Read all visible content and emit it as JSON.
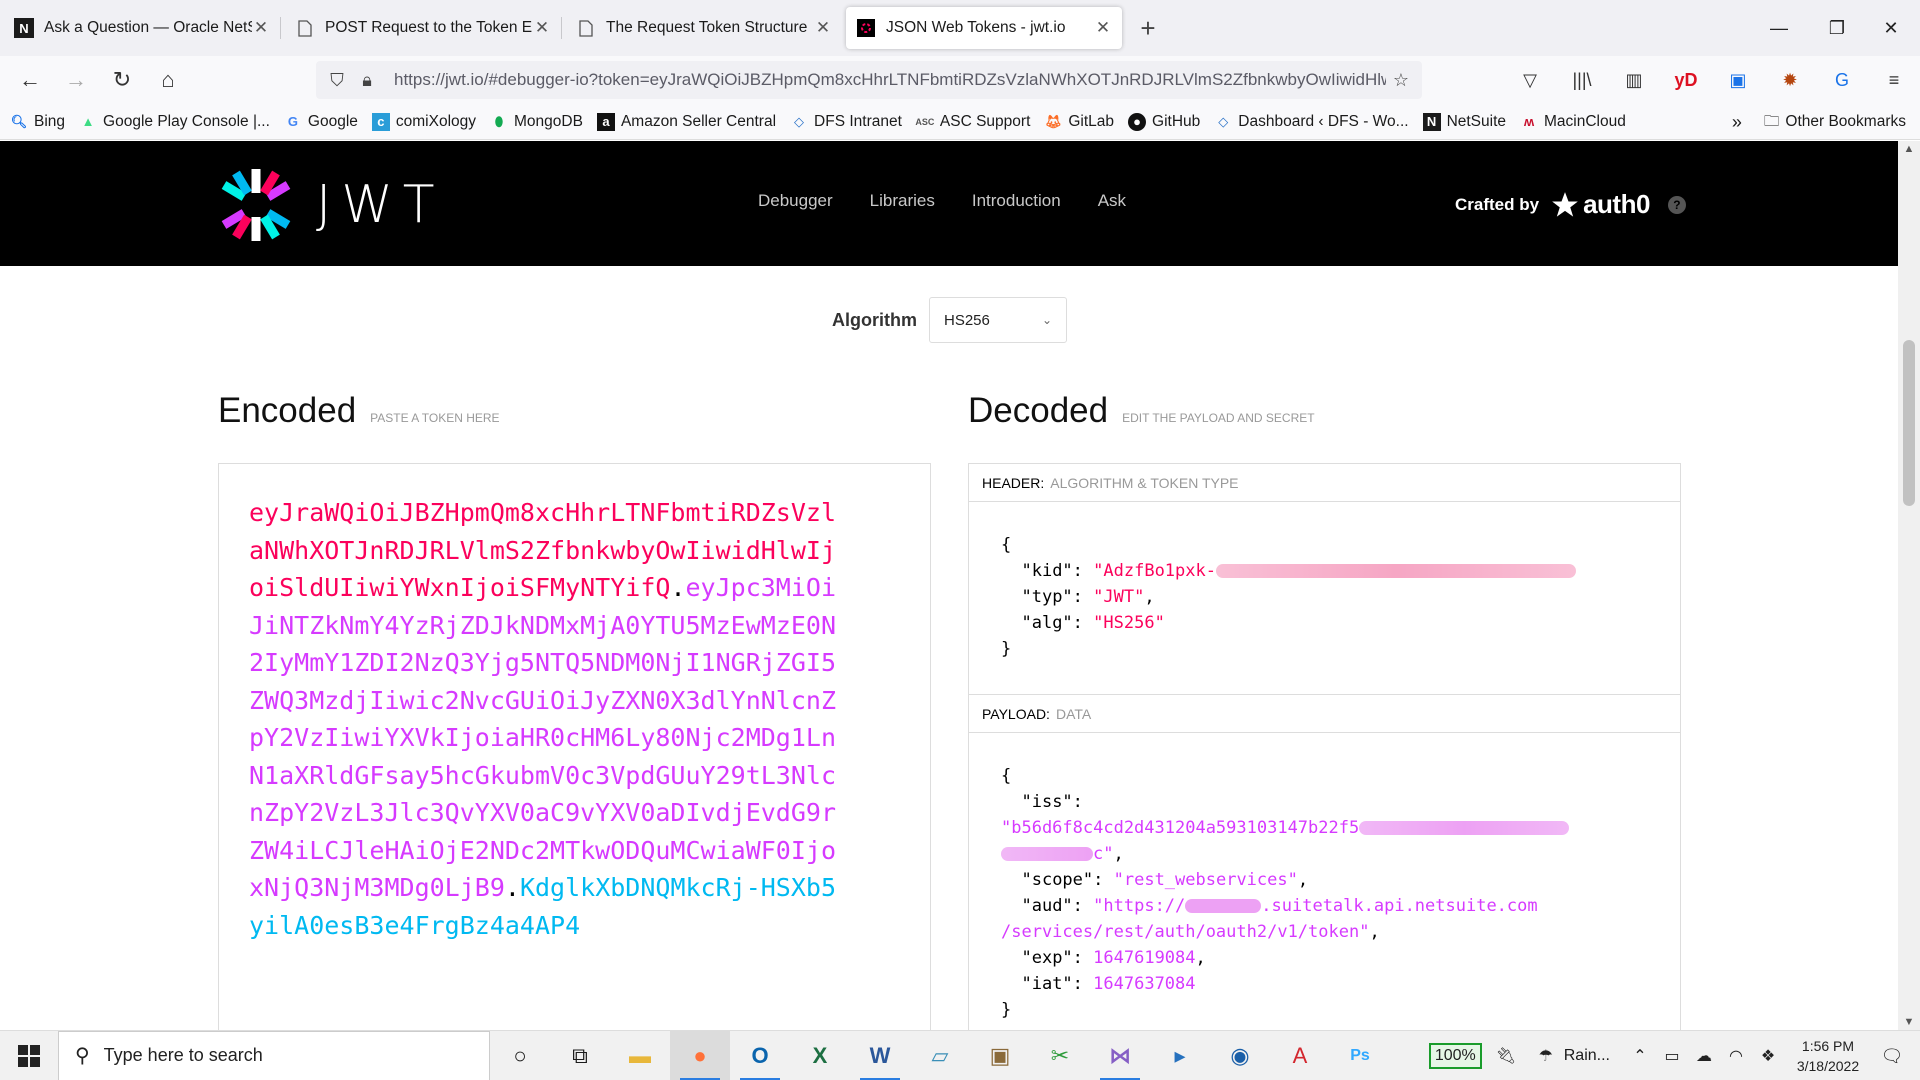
{
  "browser": {
    "tabs": [
      {
        "title": "Ask a Question — Oracle NetSu",
        "icon": "N",
        "active": false
      },
      {
        "title": "POST Request to the Token End",
        "icon": "doc",
        "active": false
      },
      {
        "title": "The Request Token Structure",
        "icon": "doc",
        "active": false
      },
      {
        "title": "JSON Web Tokens - jwt.io",
        "icon": "jwt",
        "active": true
      }
    ],
    "url": "https://jwt.io/#debugger-io?token=eyJraWQiOiJBZHpmQm8xcHhrLTNFbmtiRDZsVzlaNWhXOTJnRDJRLVlmS2ZfbnkwbyOwIiwidHlw",
    "bookmarks": [
      {
        "label": "Bing",
        "icon": "search-icon"
      },
      {
        "label": "Google Play Console |...",
        "icon": "android-icon"
      },
      {
        "label": "Google",
        "icon": "google-icon"
      },
      {
        "label": "comiXology",
        "icon": "comixology-icon"
      },
      {
        "label": "MongoDB",
        "icon": "mongodb-icon"
      },
      {
        "label": "Amazon Seller Central",
        "icon": "amazon-icon"
      },
      {
        "label": "DFS Intranet",
        "icon": "diamond-icon"
      },
      {
        "label": "ASC Support",
        "icon": "asc-icon"
      },
      {
        "label": "GitLab",
        "icon": "gitlab-icon"
      },
      {
        "label": "GitHub",
        "icon": "github-icon"
      },
      {
        "label": "Dashboard ‹ DFS - Wo...",
        "icon": "diamond-icon"
      },
      {
        "label": "NetSuite",
        "icon": "netsuite-icon"
      },
      {
        "label": "MacinCloud",
        "icon": "macincloud-icon"
      }
    ],
    "other_bookmarks": "Other Bookmarks"
  },
  "site": {
    "logo_text": "JWT",
    "nav": [
      "Debugger",
      "Libraries",
      "Introduction",
      "Ask"
    ],
    "crafted_by": "Crafted by",
    "brand": "auth0",
    "help": "?"
  },
  "debugger": {
    "algorithm_label": "Algorithm",
    "algorithm_value": "HS256",
    "encoded_title": "Encoded",
    "encoded_hint": "PASTE A TOKEN HERE",
    "decoded_title": "Decoded",
    "decoded_hint": "EDIT THE PAYLOAD AND SECRET",
    "token_header": "eyJraWQiOiJBZHpmQm8xcHhrLTNFbmtiRDZsVzlaNWhXOTJnRDJRLVlmS2ZfbnkwbyOwIiwidHlwIjoiSldUIiwiYWxnIjoiSFMyNTYifQ",
    "token_payload": "eyJpc3MiOiJiNTZkNmY4YzRjZDJkNDMxMjA0YTU5MzEwMzE0N2IyMmY1ZDI2NzQ3Yjg5NTQ5NDM0NjI1NGRjZGI5ZWQ3MzdjIiwic2NvcGUiOiJyZXN0X3dlYnNlcnZpY2VzIiwiYXVkIjoiaHR0cHM6Ly80Njc2MDg1LnN1aXRldGFsay5hcGkubmV0c3VpdGUuY29tL3NlcnZpY2VzL3Jlc3QvYXV0aC9vYXV0aDIvdjEvdG9rZW4iLCJleHAiOjE2NDc2MTkwODQuMCwiaWF0IjoxNjQ3NjM3MDg0LjB9",
    "token_signature": "KdglkXbDNQMkcRj-HSXb5yilA0esB3e4FrgBz4a4AP4",
    "header_section_key": "HEADER:",
    "header_section_val": "ALGORITHM & TOKEN TYPE",
    "payload_section_key": "PAYLOAD:",
    "payload_section_val": "DATA",
    "header_json": {
      "kid_key": "\"kid\"",
      "kid_val": "\"AdzfBo1pxk-",
      "typ_key": "\"typ\"",
      "typ_val": "\"JWT\"",
      "alg_key": "\"alg\"",
      "alg_val": "\"HS256\""
    },
    "payload_json": {
      "iss_key": "\"iss\"",
      "iss_val": "\"b56d6f8c4cd2d431204a593103147b22f5",
      "iss_end": "c\"",
      "scope_key": "\"scope\"",
      "scope_val": "\"rest_webservices\"",
      "aud_key": "\"aud\"",
      "aud_val1": "\"https://",
      "aud_val2": ".suitetalk.api.netsuite.com",
      "aud_val3": "/services/rest/auth/oauth2/v1/token\"",
      "exp_key": "\"exp\"",
      "exp_val": "1647619084",
      "iat_key": "\"iat\"",
      "iat_val": "1647637084"
    }
  },
  "taskbar": {
    "search_placeholder": "Type here to search",
    "battery": "100%",
    "weather": "Rain...",
    "time": "1:56 PM",
    "date": "3/18/2022"
  },
  "colors": {
    "header_token": "#fb015b",
    "payload_token": "#d63aff",
    "signature_token": "#00b9f1"
  }
}
